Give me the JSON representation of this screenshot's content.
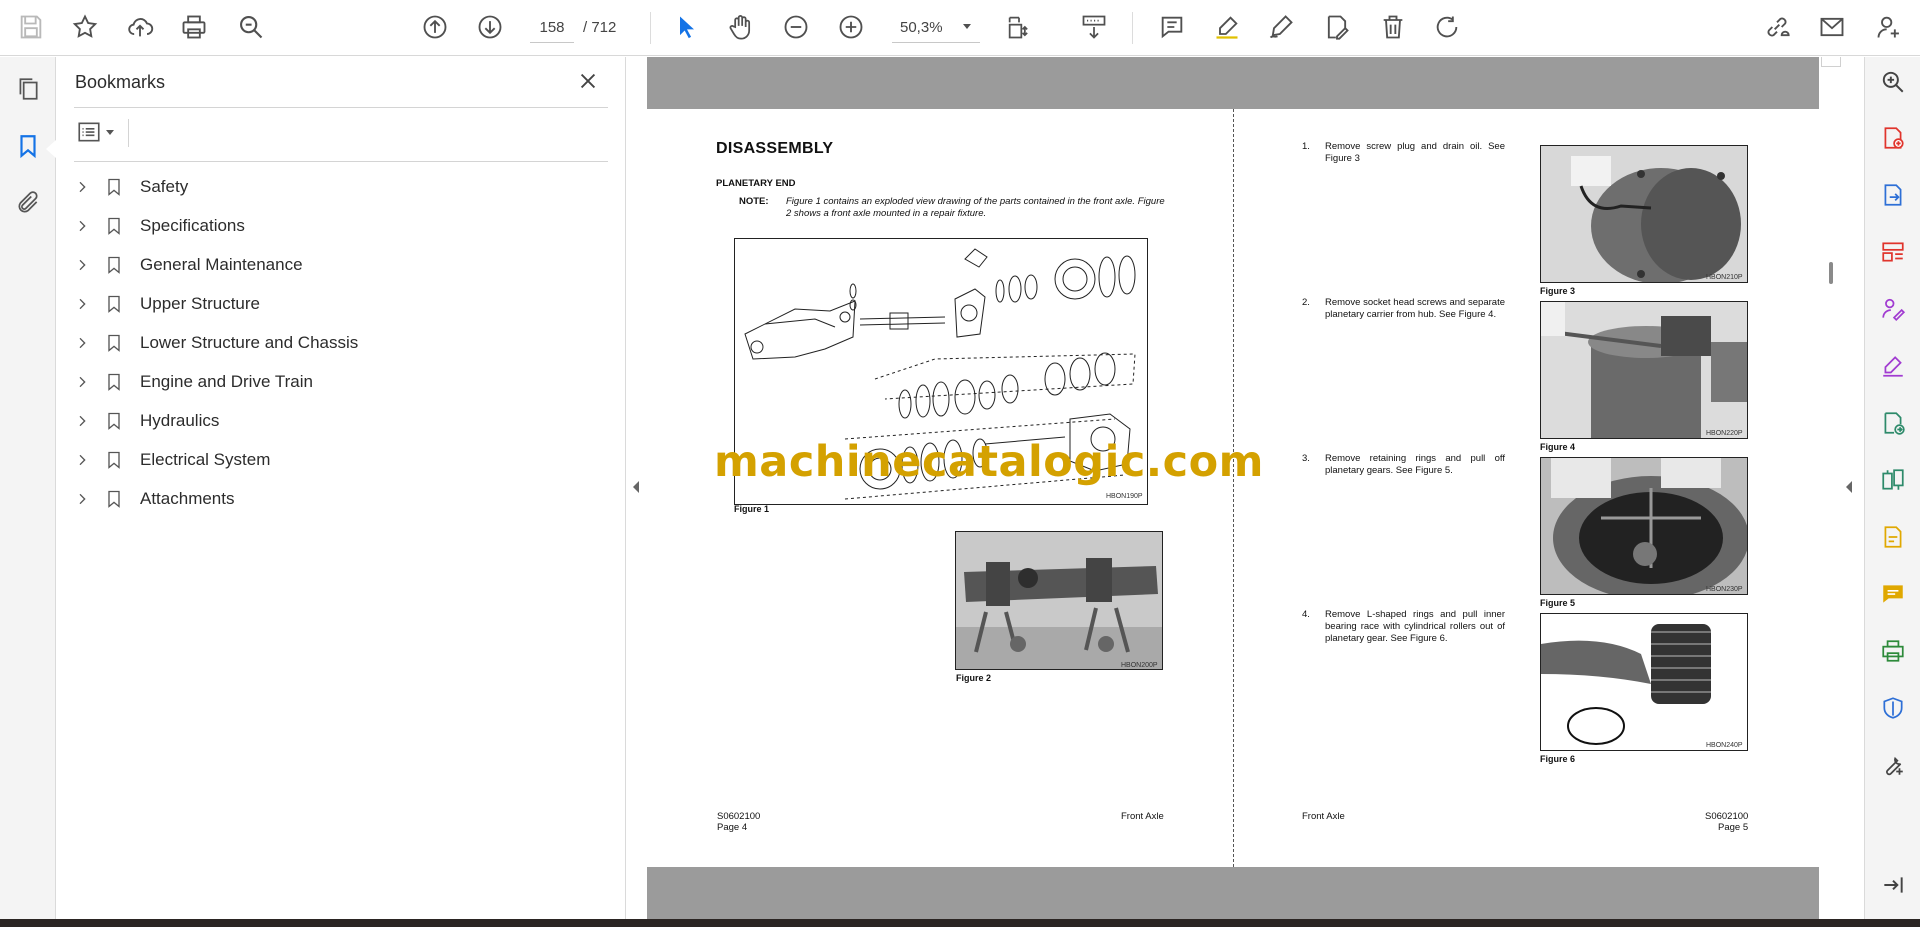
{
  "toolbar": {
    "current_page": "158",
    "total_pages": "/  712",
    "zoom": "50,3%"
  },
  "bookmarks": {
    "title": "Bookmarks",
    "items": [
      {
        "label": "Safety"
      },
      {
        "label": "Specifications"
      },
      {
        "label": "General Maintenance"
      },
      {
        "label": "Upper Structure"
      },
      {
        "label": "Lower Structure and Chassis"
      },
      {
        "label": "Engine and Drive Train"
      },
      {
        "label": "Hydraulics"
      },
      {
        "label": "Electrical System"
      },
      {
        "label": "Attachments"
      }
    ]
  },
  "document": {
    "left_page": {
      "heading": "DISASSEMBLY",
      "subheading": "PLANETARY END",
      "note_label": "NOTE:",
      "note_text": "Figure 1 contains an exploded view drawing of the parts contained in the front axle. Figure 2 shows a front axle mounted in a repair fixture.",
      "fig1_caption": "Figure 1",
      "fig1_code": "HBON190P",
      "fig2_caption": "Figure 2",
      "fig2_code": "HBON200P",
      "footer_code": "S0602100",
      "footer_page": "Page 4",
      "footer_section": "Front Axle"
    },
    "right_page": {
      "steps": [
        {
          "num": "1.",
          "text": "Remove screw plug and drain oil. See Figure 3"
        },
        {
          "num": "2.",
          "text": "Remove socket head screws and separate planetary carrier from hub. See Figure 4."
        },
        {
          "num": "3.",
          "text": "Remove retaining rings and pull off planetary gears. See Figure 5."
        },
        {
          "num": "4.",
          "text": "Remove L-shaped rings and pull inner bearing race with cylindrical rollers out of planetary gear. See Figure 6."
        }
      ],
      "figures": [
        {
          "caption": "Figure 3",
          "code": "HBON210P"
        },
        {
          "caption": "Figure 4",
          "code": "HBON220P"
        },
        {
          "caption": "Figure 5",
          "code": "HBON230P"
        },
        {
          "caption": "Figure 6",
          "code": "HBON240P"
        }
      ],
      "footer_section": "Front Axle",
      "footer_code": "S0602100",
      "footer_page": "Page 5"
    },
    "watermark": "machinecatalogic.com"
  },
  "colors": {
    "accent": "#1473e6",
    "watermark": "#d4a100",
    "doc_gray": "#9b9b9b"
  }
}
